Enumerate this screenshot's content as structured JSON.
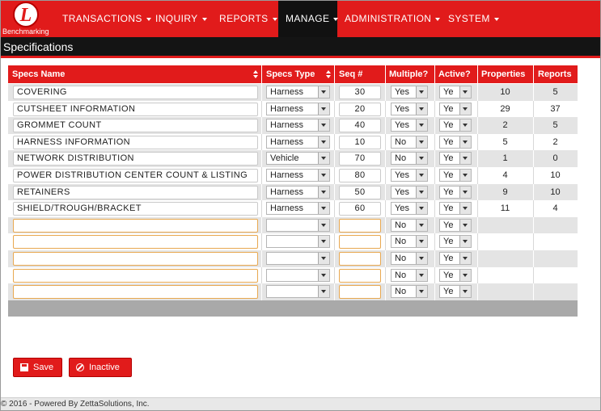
{
  "nav": {
    "logo_text": "Benchmarking",
    "logo_letter": "L",
    "items": [
      {
        "label": "TRANSACTIONS",
        "active": false
      },
      {
        "label": "INQUIRY",
        "active": false
      },
      {
        "label": "REPORTS",
        "active": false
      },
      {
        "label": "MANAGE",
        "active": true
      },
      {
        "label": "ADMINISTRATION",
        "active": false
      },
      {
        "label": "SYSTEM",
        "active": false
      }
    ]
  },
  "page": {
    "title": "Specifications"
  },
  "grid": {
    "headers": [
      "Specs Name",
      "Specs Type",
      "Seq #",
      "Multiple?",
      "Active?",
      "Properties",
      "Reports"
    ],
    "rows": [
      {
        "name": "COVERING",
        "type": "Harness",
        "seq": "30",
        "multiple": "Yes",
        "active": "Ye",
        "properties": "10",
        "reports": "5"
      },
      {
        "name": "CUTSHEET INFORMATION",
        "type": "Harness",
        "seq": "20",
        "multiple": "Yes",
        "active": "Ye",
        "properties": "29",
        "reports": "37"
      },
      {
        "name": "GROMMET COUNT",
        "type": "Harness",
        "seq": "40",
        "multiple": "Yes",
        "active": "Ye",
        "properties": "2",
        "reports": "5"
      },
      {
        "name": "HARNESS INFORMATION",
        "type": "Harness",
        "seq": "10",
        "multiple": "No",
        "active": "Ye",
        "properties": "5",
        "reports": "2"
      },
      {
        "name": "NETWORK DISTRIBUTION",
        "type": "Vehicle",
        "seq": "70",
        "multiple": "No",
        "active": "Ye",
        "properties": "1",
        "reports": "0"
      },
      {
        "name": "POWER DISTRIBUTION CENTER COUNT & LISTING",
        "type": "Harness",
        "seq": "80",
        "multiple": "Yes",
        "active": "Ye",
        "properties": "4",
        "reports": "10"
      },
      {
        "name": "RETAINERS",
        "type": "Harness",
        "seq": "50",
        "multiple": "Yes",
        "active": "Ye",
        "properties": "9",
        "reports": "10"
      },
      {
        "name": "SHIELD/TROUGH/BRACKET",
        "type": "Harness",
        "seq": "60",
        "multiple": "Yes",
        "active": "Ye",
        "properties": "11",
        "reports": "4"
      },
      {
        "name": "",
        "type": "",
        "seq": "",
        "multiple": "No",
        "active": "Ye",
        "properties": "",
        "reports": ""
      },
      {
        "name": "",
        "type": "",
        "seq": "",
        "multiple": "No",
        "active": "Ye",
        "properties": "",
        "reports": ""
      },
      {
        "name": "",
        "type": "",
        "seq": "",
        "multiple": "No",
        "active": "Ye",
        "properties": "",
        "reports": ""
      },
      {
        "name": "",
        "type": "",
        "seq": "",
        "multiple": "No",
        "active": "Ye",
        "properties": "",
        "reports": ""
      },
      {
        "name": "",
        "type": "",
        "seq": "",
        "multiple": "No",
        "active": "Ye",
        "properties": "",
        "reports": ""
      }
    ]
  },
  "actions": {
    "save_label": "Save",
    "inactive_label": "Inactive"
  },
  "footer": {
    "text": "© 2016 - Powered By ZettaSolutions, Inc."
  },
  "colors": {
    "brand_red": "#e11b1b",
    "dark_bar": "#141414"
  }
}
